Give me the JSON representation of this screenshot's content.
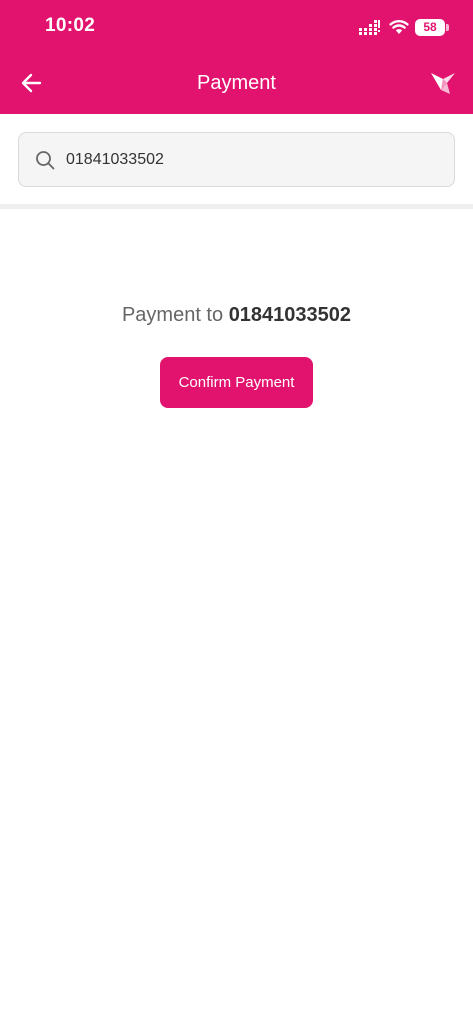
{
  "status_bar": {
    "time": "10:02",
    "battery": "58"
  },
  "header": {
    "title": "Payment",
    "back_icon": "arrow-left-icon",
    "logo_icon": "bird-logo-icon"
  },
  "search": {
    "icon": "search-icon",
    "value": "01841033502"
  },
  "payment": {
    "prefix": "Payment to",
    "number": "01841033502",
    "confirm_label": "Confirm Payment"
  },
  "colors": {
    "brand": "#e2136e"
  }
}
